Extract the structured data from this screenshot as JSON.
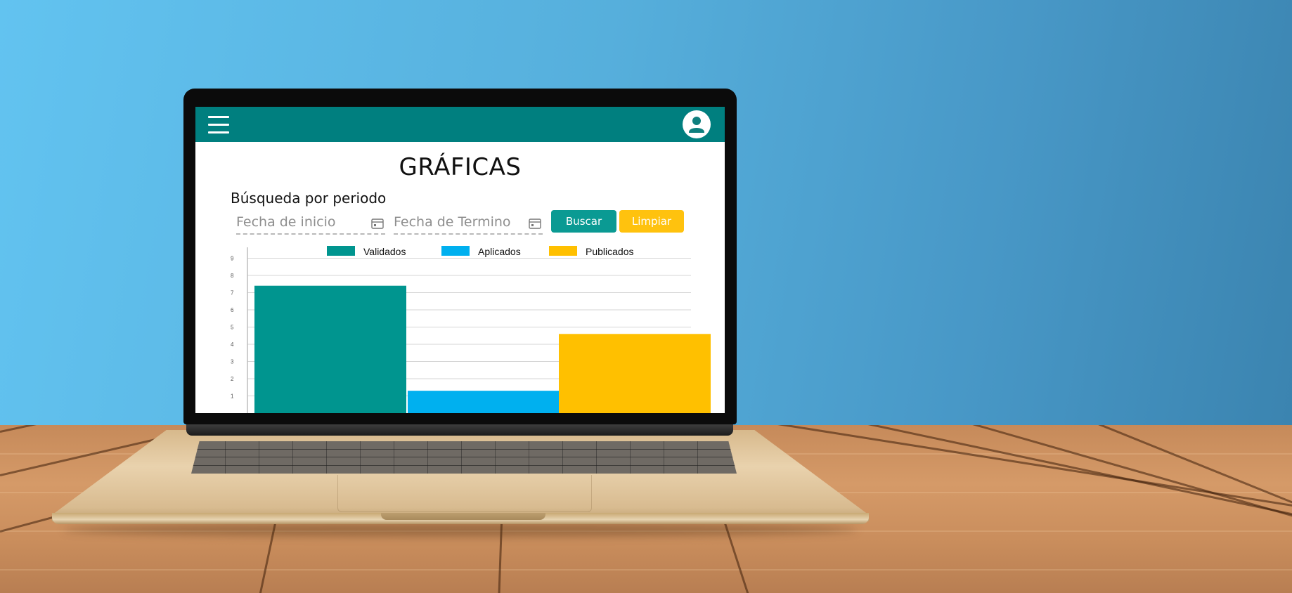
{
  "app": {
    "title": "GRÁFICAS",
    "search_label": "Búsqueda por periodo",
    "start_date": {
      "placeholder": "Fecha de inicio",
      "value": ""
    },
    "end_date": {
      "placeholder": "Fecha de Termino",
      "value": ""
    },
    "search_button": "Buscar",
    "clear_button": "Limpiar"
  },
  "icons": {
    "menu": "hamburger-menu-icon",
    "account": "user-avatar-icon",
    "calendar": "calendar-icon"
  },
  "colors": {
    "appbar": "#007f7f",
    "search_button": "#0a9a93",
    "clear_button": "#ffc20e"
  },
  "chart_data": {
    "type": "bar",
    "title": "",
    "xlabel": "",
    "ylabel": "",
    "ylim": [
      0,
      9
    ],
    "y_ticks": [
      "1",
      "2",
      "3",
      "4",
      "5",
      "6",
      "7",
      "8",
      "9"
    ],
    "grid": true,
    "legend_position": "top",
    "series": [
      {
        "name": "Validados",
        "color": "#00958f",
        "value": 7.4
      },
      {
        "name": "Aplicados",
        "color": "#00b0ef",
        "value": 1.3
      },
      {
        "name": "Publicados",
        "color": "#ffc000",
        "value": 4.6
      }
    ]
  }
}
